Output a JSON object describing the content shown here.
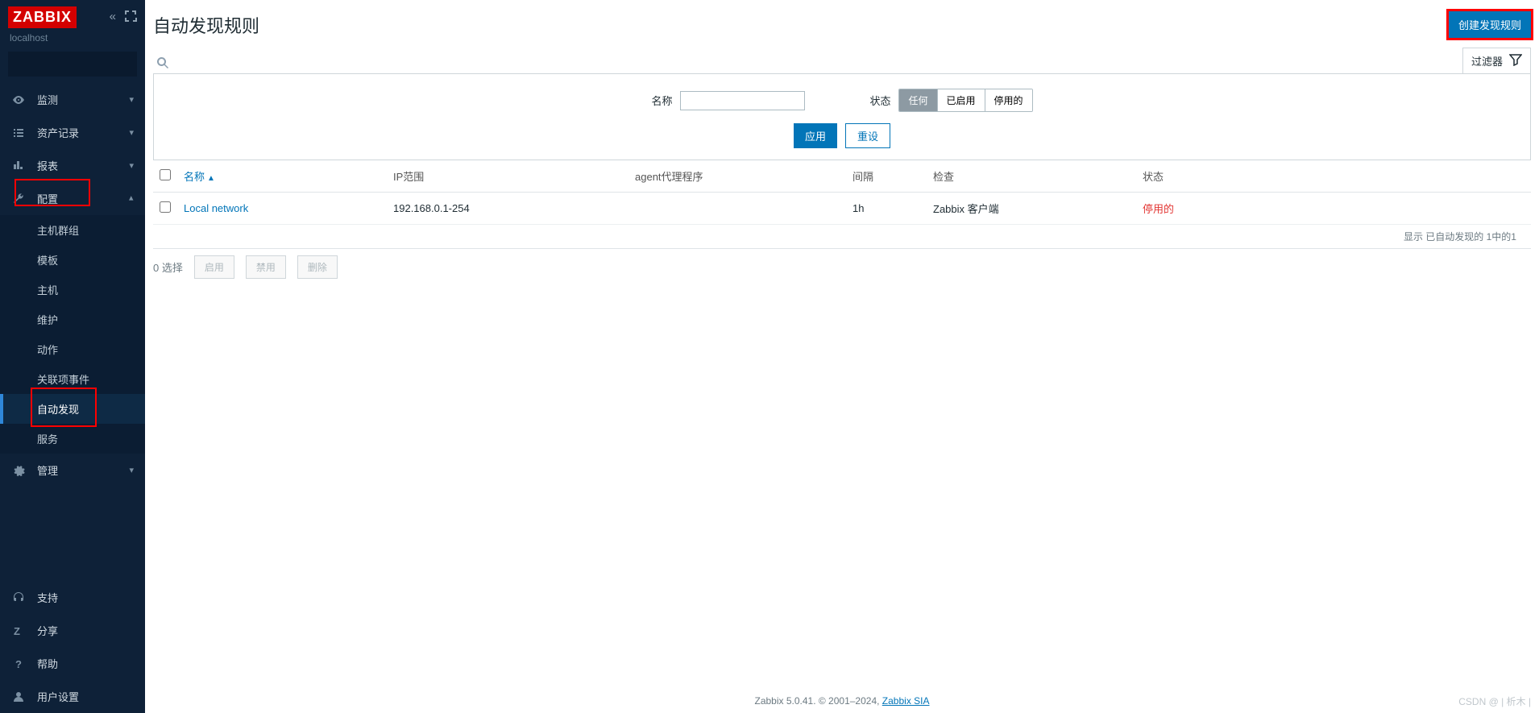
{
  "brand": "ZABBIX",
  "server_name": "localhost",
  "search": {
    "placeholder": ""
  },
  "nav": {
    "monitoring": "监测",
    "inventory": "资产记录",
    "reports": "报表",
    "config": "配置",
    "admin": "管理",
    "config_items": {
      "hostgroups": "主机群组",
      "templates": "模板",
      "hosts": "主机",
      "maintenance": "维护",
      "actions": "动作",
      "correlation": "关联项事件",
      "discovery": "自动发现",
      "services": "服务"
    }
  },
  "bottom_nav": {
    "support": "支持",
    "share": "分享",
    "help": "帮助",
    "usersettings": "用户设置"
  },
  "page": {
    "title": "自动发现规则",
    "create_button": "创建发现规则"
  },
  "filter": {
    "toggle": "过滤器",
    "name_label": "名称",
    "name_value": "",
    "status_label": "状态",
    "status_opts": {
      "any": "任何",
      "enabled": "已启用",
      "disabled": "停用的"
    },
    "apply": "应用",
    "reset": "重设"
  },
  "table": {
    "headers": {
      "name": "名称",
      "ip": "IP范围",
      "proxy": "agent代理程序",
      "interval": "间隔",
      "checks": "检查",
      "status": "状态"
    },
    "rows": [
      {
        "name": "Local network",
        "ip": "192.168.0.1-254",
        "proxy": "",
        "interval": "1h",
        "checks": "Zabbix 客户端",
        "status": "停用的"
      }
    ],
    "footer": "显示 已自动发现的 1中的1"
  },
  "batch": {
    "selected": "0 选择",
    "enable": "启用",
    "disable": "禁用",
    "delete": "删除"
  },
  "footer": {
    "text1": "Zabbix 5.0.41. © 2001–2024, ",
    "link": "Zabbix SIA"
  },
  "watermark": "CSDN @ | 析木 |"
}
